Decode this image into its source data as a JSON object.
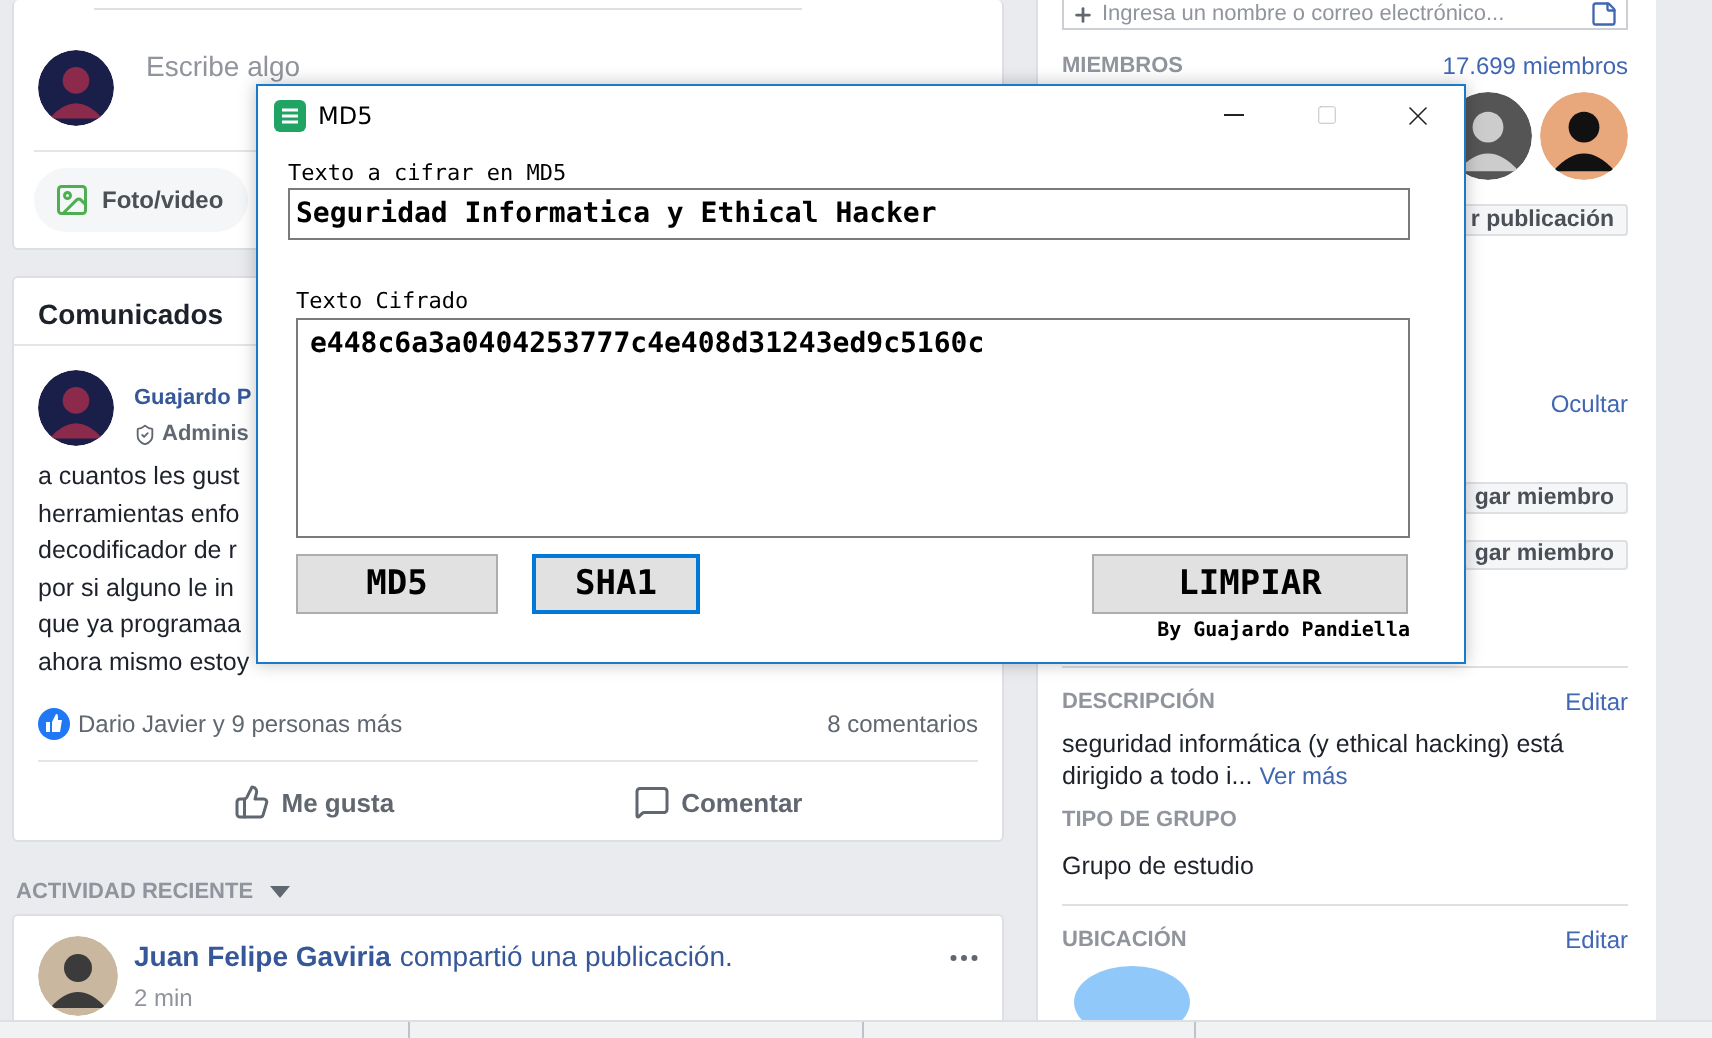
{
  "composer": {
    "placeholder": "Escribe algo",
    "actions": [
      {
        "label": "Foto/video"
      }
    ]
  },
  "announcements": {
    "title": "Comunicados",
    "post": {
      "author": "Guajardo P",
      "role": "Adminis",
      "lines": [
        "a cuantos les gust",
        "herramientas enfo",
        "decodificador de r",
        "por si alguno le in",
        "que ya programaa",
        "ahora mismo estoy"
      ],
      "reactions": "Dario Javier y 9 personas más",
      "comments": "8 comentarios",
      "actions": [
        {
          "kind": "like",
          "label": "Me gusta"
        },
        {
          "kind": "comment",
          "label": "Comentar"
        }
      ]
    }
  },
  "recent_activity": {
    "title": "ACTIVIDAD RECIENTE",
    "items": [
      {
        "author": "Juan Felipe Gaviria",
        "action": "compartió una publicación.",
        "time": "2 min"
      }
    ]
  },
  "sidebar": {
    "invite": {
      "placeholder": "Ingresa un nombre o correo electrónico..."
    },
    "members": {
      "title": "MIEMBROS",
      "count": "17.699 miembros"
    },
    "post_button": "r publicación",
    "hide_link": "Ocultar",
    "member_buttons": [
      "gar miembro",
      "gar miembro"
    ],
    "description": {
      "title": "DESCRIPCIÓN",
      "edit": "Editar",
      "text": "seguridad informática (y ethical hacking) está dirigido a todo i...",
      "more": "Ver más"
    },
    "group_type": {
      "title": "TIPO DE GRUPO",
      "value": "Grupo de estudio"
    },
    "location": {
      "title": "UBICACIÓN",
      "edit": "Editar"
    }
  },
  "dialog": {
    "title": "MD5",
    "input_label": "Texto a cifrar en MD5",
    "input_value": "Seguridad Informatica y Ethical Hacker",
    "output_label": "Texto Cifrado",
    "output_value": "e448c6a3a0404253777c4e408d31243ed9c5160c",
    "buttons": [
      {
        "label": "MD5",
        "focused": false,
        "kind": "hash"
      },
      {
        "label": "SHA1",
        "focused": true,
        "kind": "hash"
      },
      {
        "label": "LIMPIAR",
        "focused": false,
        "kind": "clear"
      }
    ],
    "credit": "By Guajardo Pandiella"
  }
}
